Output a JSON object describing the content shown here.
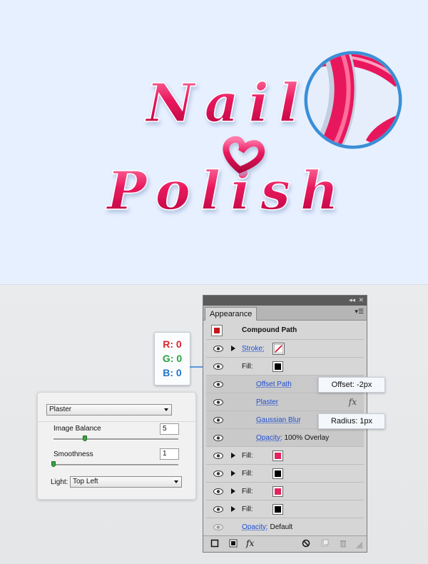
{
  "artwork": {
    "line1": "Nail",
    "line2": "Polish",
    "colors": {
      "background": "#e7f0ff",
      "text": "#e2185a",
      "magnifier_ring": "#3a8fd6"
    }
  },
  "rgb_callout": {
    "r": "R: 0",
    "g": "G: 0",
    "b": "B: 0"
  },
  "appearance_panel": {
    "tab": "Appearance",
    "title": "Compound Path",
    "rows": [
      {
        "label": "Stroke:",
        "swatch": "none-icon",
        "expand": true,
        "link": true
      },
      {
        "label": "Fill:",
        "swatch": "black",
        "expand": false,
        "link": false
      },
      {
        "label": "Offset Path",
        "link": true,
        "indent": true
      },
      {
        "label": "Plaster",
        "link": true,
        "indent": true,
        "fx": "fx"
      },
      {
        "label": "Gaussian Blur",
        "link": true,
        "indent": true
      },
      {
        "label": "Opacity:",
        "value": "100% Overlay",
        "link": true,
        "indent": true
      },
      {
        "label": "Fill:",
        "swatch": "pink",
        "expand": true
      },
      {
        "label": "Fill:",
        "swatch": "black",
        "expand": true
      },
      {
        "label": "Fill:",
        "swatch": "pink",
        "expand": true
      },
      {
        "label": "Fill:",
        "swatch": "black",
        "expand": true
      },
      {
        "label": "Opacity:",
        "value": "Default",
        "link": true
      }
    ],
    "bottom_fx_label": "fx"
  },
  "callouts": {
    "offset": "Offset: -2px",
    "radius": "Radius: 1px"
  },
  "plaster_dialog": {
    "filter": "Plaster",
    "image_balance_label": "Image Balance",
    "image_balance_value": "5",
    "image_balance_level": 0.25,
    "smoothness_label": "Smoothness",
    "smoothness_value": "1",
    "smoothness_level": 0.0,
    "light_label": "Light:",
    "light_value": "Top Left"
  }
}
